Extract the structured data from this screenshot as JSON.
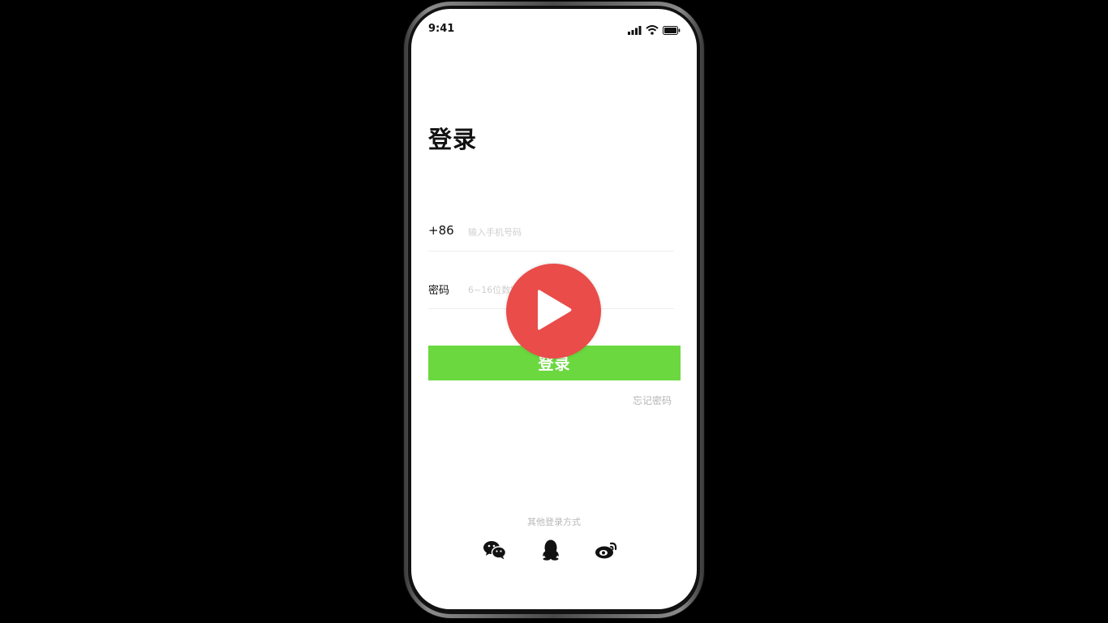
{
  "status_bar": {
    "time": "9:41"
  },
  "page": {
    "title": "登录"
  },
  "phone_field": {
    "prefix": "+86",
    "placeholder": "输入手机号码"
  },
  "password_field": {
    "label": "密码",
    "placeholder": "6~16位数字或字母"
  },
  "login_button": {
    "label": "登录"
  },
  "forgot_link": {
    "label": "忘记密码"
  },
  "other_login": {
    "label": "其他登录方式",
    "options": [
      {
        "icon": "wechat-icon"
      },
      {
        "icon": "qq-icon"
      },
      {
        "icon": "weibo-icon"
      }
    ]
  },
  "video_overlay": {
    "icon": "play-icon"
  },
  "colors": {
    "accent_green": "#6bd83f",
    "play_red": "#e94c49",
    "placeholder_gray": "#cfcfcf",
    "link_gray": "#b5b5b5"
  }
}
